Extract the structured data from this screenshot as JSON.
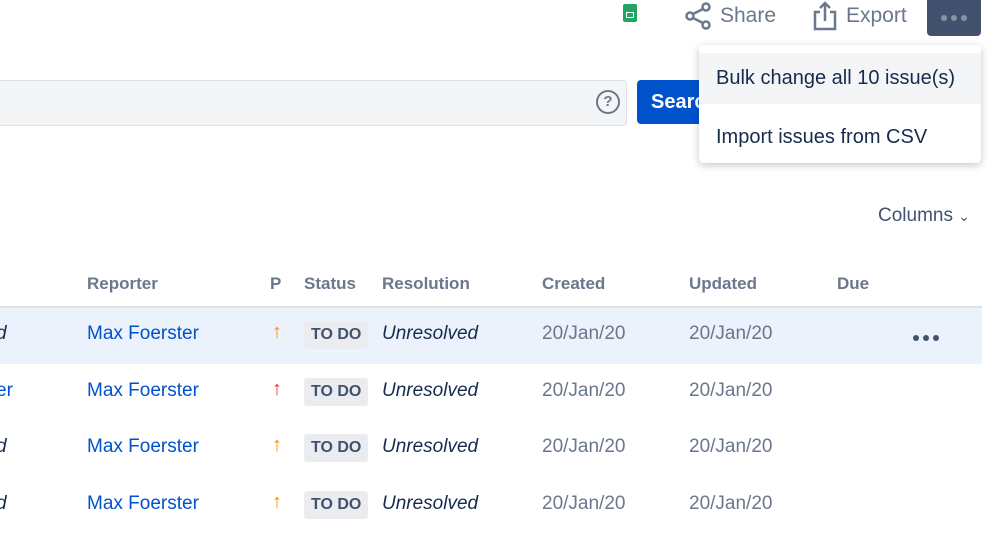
{
  "toolbar": {
    "share_label": "Share",
    "export_label": "Export"
  },
  "menu": {
    "items": [
      "Bulk change all 10 issue(s)",
      "Import issues from CSV"
    ]
  },
  "search": {
    "button_label": "Search",
    "help": "?"
  },
  "columns_label": "Columns",
  "table": {
    "headers": [
      "Reporter",
      "P",
      "Status",
      "Resolution",
      "Created",
      "Updated",
      "Due"
    ],
    "rows": [
      {
        "prev": "d",
        "prev_style": "italic",
        "reporter": "Max Foerster",
        "priority_color": "#ff8b00",
        "status": "TO DO",
        "resolution": "Unresolved",
        "created": "20/Jan/20",
        "updated": "20/Jan/20",
        "due": ""
      },
      {
        "prev": "er",
        "prev_style": "link",
        "reporter": "Max Foerster",
        "priority_color": "#e5343a",
        "status": "TO DO",
        "resolution": "Unresolved",
        "created": "20/Jan/20",
        "updated": "20/Jan/20",
        "due": ""
      },
      {
        "prev": "d",
        "prev_style": "italic",
        "reporter": "Max Foerster",
        "priority_color": "#ff8b00",
        "status": "TO DO",
        "resolution": "Unresolved",
        "created": "20/Jan/20",
        "updated": "20/Jan/20",
        "due": ""
      },
      {
        "prev": "d",
        "prev_style": "italic",
        "reporter": "Max Foerster",
        "priority_color": "#ff8b00",
        "status": "TO DO",
        "resolution": "Unresolved",
        "created": "20/Jan/20",
        "updated": "20/Jan/20",
        "due": ""
      }
    ]
  }
}
